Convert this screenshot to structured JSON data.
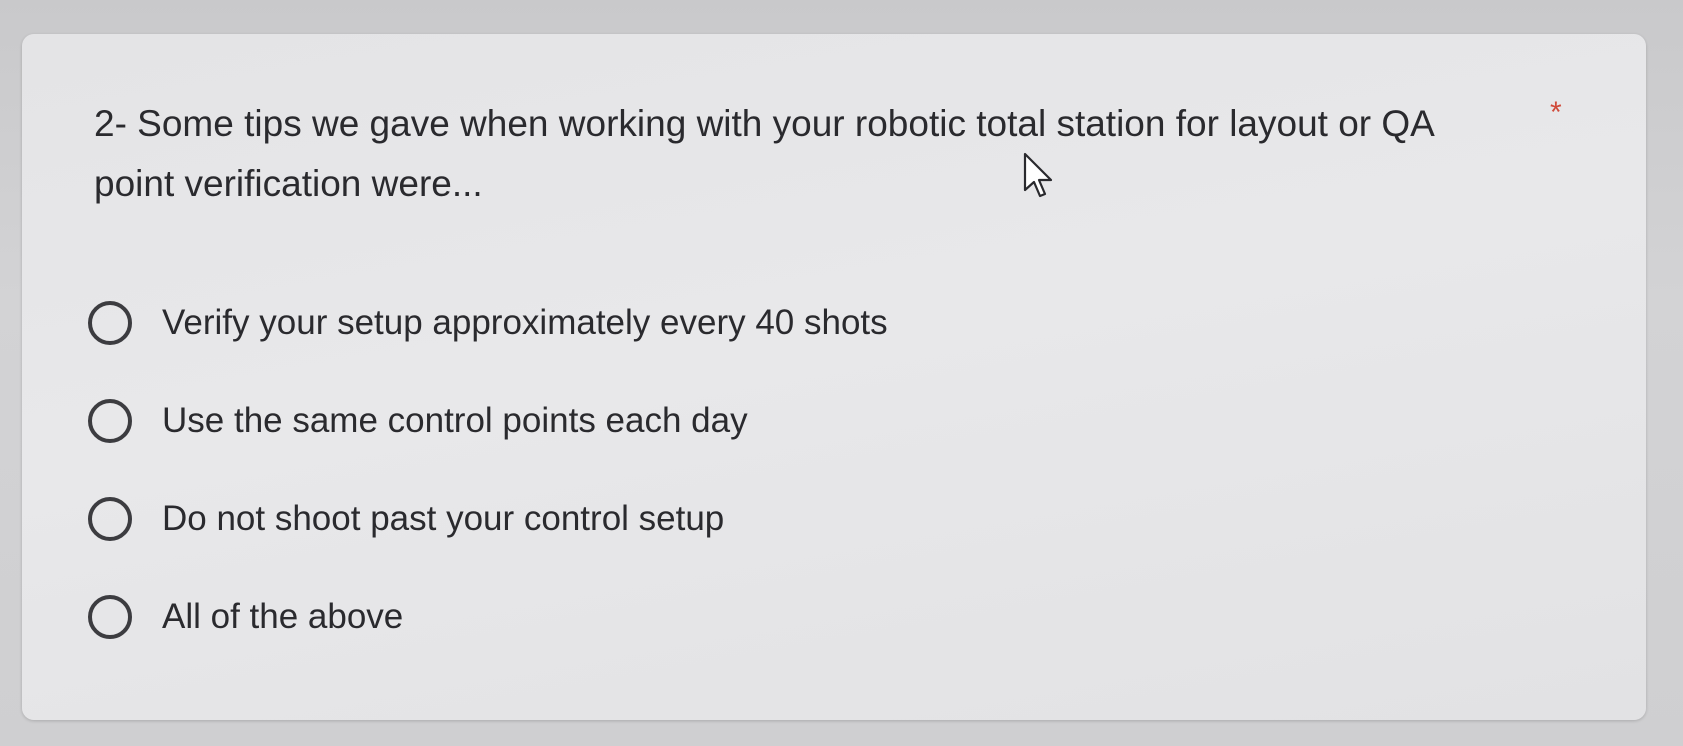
{
  "question": {
    "text": "2- Some tips we gave when working with your robotic total station for layout or QA point verification were...",
    "required_marker": "*"
  },
  "options": [
    {
      "label": "Verify your setup approximately every 40 shots",
      "selected": false
    },
    {
      "label": "Use the same control points each day",
      "selected": false
    },
    {
      "label": "Do not shoot past your control setup",
      "selected": false
    },
    {
      "label": "All of the above",
      "selected": false
    }
  ],
  "colors": {
    "required_star": "#d04a3a",
    "text": "#2a2a2e",
    "card_background": "#e6e6e8"
  },
  "icons": {
    "cursor": "mouse-pointer-icon",
    "radio": "radio-unchecked-icon"
  }
}
